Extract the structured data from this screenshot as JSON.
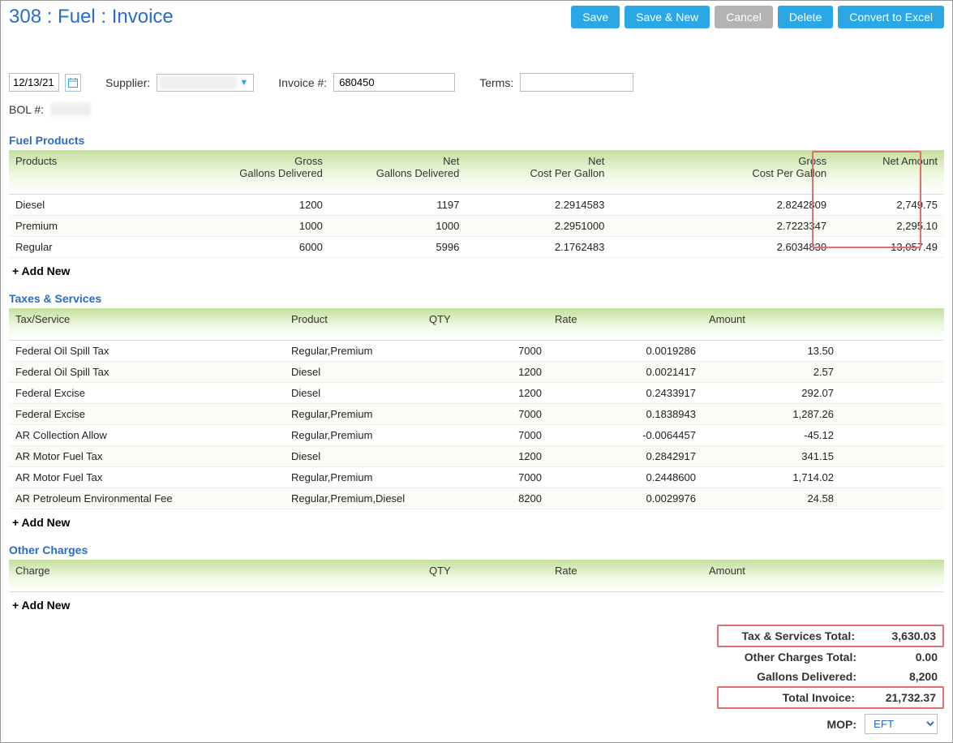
{
  "header": {
    "title": "308 : Fuel : Invoice",
    "buttons": {
      "save": "Save",
      "save_new": "Save & New",
      "cancel": "Cancel",
      "delete": "Delete",
      "convert": "Convert to Excel"
    }
  },
  "filters": {
    "date": "12/13/21",
    "supplier_label": "Supplier:",
    "invoice_label": "Invoice #:",
    "invoice_value": "680450",
    "terms_label": "Terms:",
    "bol_label": "BOL #:"
  },
  "fuel": {
    "title": "Fuel Products",
    "columns": {
      "c0": "Products",
      "c1a": "Gross",
      "c1b": "Gallons Delivered",
      "c2a": "Net",
      "c2b": "Gallons Delivered",
      "c3a": "Net",
      "c3b": "Cost Per Gallon",
      "c4a": "Gross",
      "c4b": "Cost Per Gallon",
      "c5": "Net Amount"
    },
    "rows": [
      {
        "product": "Diesel",
        "gross_gal": "1200",
        "net_gal": "1197",
        "net_cpg": "2.2914583",
        "gross_cpg": "2.8242809",
        "net_amt": "2,749.75"
      },
      {
        "product": "Premium",
        "gross_gal": "1000",
        "net_gal": "1000",
        "net_cpg": "2.2951000",
        "gross_cpg": "2.7223347",
        "net_amt": "2,295.10"
      },
      {
        "product": "Regular",
        "gross_gal": "6000",
        "net_gal": "5996",
        "net_cpg": "2.1762483",
        "gross_cpg": "2.6034830",
        "net_amt": "13,057.49"
      }
    ],
    "add_new": "+ Add New"
  },
  "tax": {
    "title": "Taxes & Services",
    "columns": {
      "c0": "Tax/Service",
      "c1": "Product",
      "c2": "QTY",
      "c3": "Rate",
      "c4": "Amount"
    },
    "rows": [
      {
        "svc": "Federal Oil Spill Tax",
        "prod": "Regular,Premium",
        "qty": "7000",
        "rate": "0.0019286",
        "amt": "13.50"
      },
      {
        "svc": "Federal Oil Spill Tax",
        "prod": "Diesel",
        "qty": "1200",
        "rate": "0.0021417",
        "amt": "2.57"
      },
      {
        "svc": "Federal Excise",
        "prod": "Diesel",
        "qty": "1200",
        "rate": "0.2433917",
        "amt": "292.07"
      },
      {
        "svc": "Federal Excise",
        "prod": "Regular,Premium",
        "qty": "7000",
        "rate": "0.1838943",
        "amt": "1,287.26"
      },
      {
        "svc": "AR Collection Allow",
        "prod": "Regular,Premium",
        "qty": "7000",
        "rate": "-0.0064457",
        "amt": "-45.12"
      },
      {
        "svc": "AR Motor Fuel Tax",
        "prod": "Diesel",
        "qty": "1200",
        "rate": "0.2842917",
        "amt": "341.15"
      },
      {
        "svc": "AR Motor Fuel Tax",
        "prod": "Regular,Premium",
        "qty": "7000",
        "rate": "0.2448600",
        "amt": "1,714.02"
      },
      {
        "svc": "AR Petroleum Environmental Fee",
        "prod": "Regular,Premium,Diesel",
        "qty": "8200",
        "rate": "0.0029976",
        "amt": "24.58"
      }
    ],
    "add_new": "+ Add New"
  },
  "charges": {
    "title": "Other Charges",
    "columns": {
      "c0": "Charge",
      "c1": "QTY",
      "c2": "Rate",
      "c3": "Amount"
    },
    "add_new": "+ Add New"
  },
  "totals": {
    "tax_label": "Tax & Services Total:",
    "tax_value": "3,630.03",
    "other_label": "Other Charges Total:",
    "other_value": "0.00",
    "gal_label": "Gallons Delivered:",
    "gal_value": "8,200",
    "inv_label": "Total Invoice:",
    "inv_value": "21,732.37",
    "mop_label": "MOP:",
    "mop_value": "EFT"
  }
}
